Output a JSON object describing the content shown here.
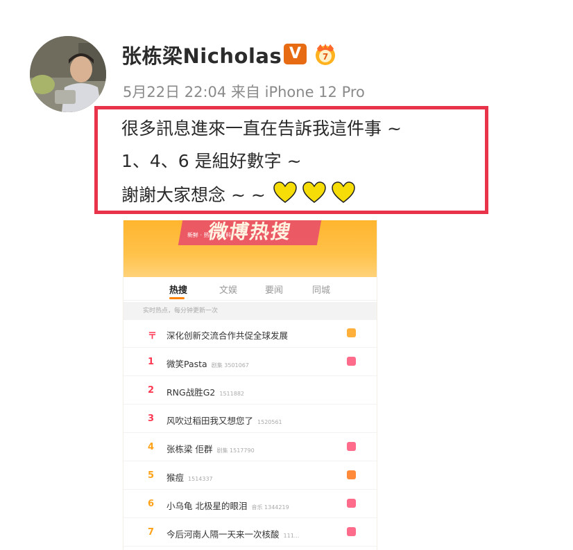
{
  "post": {
    "username": "张栋梁Nicholas",
    "verified_badge": "V",
    "meta": "5月22日 22:04 来自 iPhone 12 Pro",
    "lines": [
      "很多訊息進來一直在告訴我這件事 ~",
      "1、4、6 是組好數字 ~",
      "謝謝大家想念 ~ ~"
    ],
    "heart_color": "#f5d90a",
    "highlight_border_color": "#e8334a"
  },
  "screenshot": {
    "banner_title": "微博热搜",
    "banner_subtitle": "新鲜 · 热门 · 有料",
    "tabs": [
      {
        "label": "热搜",
        "active": true
      },
      {
        "label": "文娱",
        "active": false
      },
      {
        "label": "要闻",
        "active": false
      },
      {
        "label": "同城",
        "active": false
      }
    ],
    "hint": "实时热点，每分钟更新一次",
    "rows": [
      {
        "rank": "〒",
        "title": "深化创新交流合作共促全球发展",
        "count": "",
        "tag_color": "#ffb03a",
        "rank_style": "top"
      },
      {
        "rank": "1",
        "title": "微笑Pasta",
        "count": "剧集 3501067",
        "tag_color": "#ff6b8b",
        "rank_style": "top"
      },
      {
        "rank": "2",
        "title": "RNG战胜G2",
        "count": "1511882",
        "tag_color": "",
        "rank_style": "top"
      },
      {
        "rank": "3",
        "title": "风吹过稻田我又想您了",
        "count": "1520561",
        "tag_color": "",
        "rank_style": "top"
      },
      {
        "rank": "4",
        "title": "张栋梁 佢群",
        "count": "剧集 1517790",
        "tag_color": "#ff6b8b",
        "rank_style": "gold"
      },
      {
        "rank": "5",
        "title": "猴痘",
        "count": "1514337",
        "tag_color": "#ff8a3a",
        "rank_style": "gold"
      },
      {
        "rank": "6",
        "title": "小乌龟 北极星的眼泪",
        "count": "音乐 1344219",
        "tag_color": "#ff6b8b",
        "rank_style": "gold"
      },
      {
        "rank": "7",
        "title": "今后河南人隔一天来一次核酸",
        "count": "111...",
        "tag_color": "#ff6b8b",
        "rank_style": "gold"
      }
    ]
  }
}
